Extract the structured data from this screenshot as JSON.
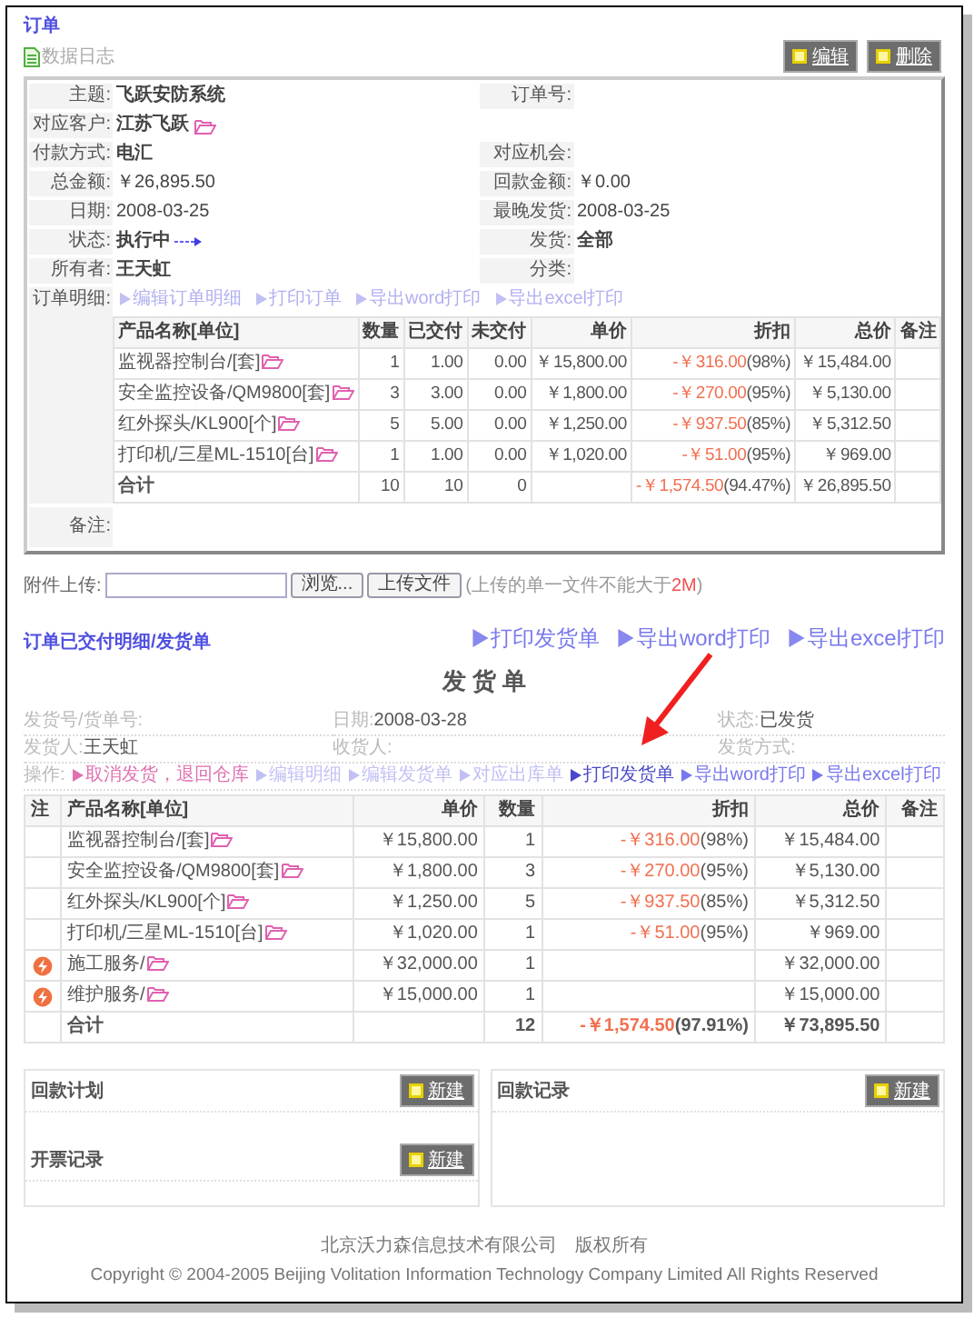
{
  "header": {
    "title": "订单",
    "log_link": "数据日志",
    "buttons": [
      "编辑",
      "删除"
    ]
  },
  "order_info": {
    "rows": [
      [
        {
          "label": "主题:",
          "value": "飞跃安防系统",
          "kind": "bold"
        },
        {
          "label": "订单号:"
        }
      ],
      [
        {
          "label": "对应客户:",
          "value": "江苏飞跃",
          "kind": "customer"
        }
      ],
      [
        {
          "label": "付款方式:",
          "value": "电汇",
          "kind": "bold"
        },
        {
          "label": "对应机会:"
        }
      ],
      [
        {
          "label": "总金额:",
          "value": "￥26,895.50",
          "kind": "plain"
        },
        {
          "label": "回款金额:",
          "value": "￥0.00",
          "kind": "plain"
        }
      ],
      [
        {
          "label": "日期:",
          "value": "2008-03-25",
          "kind": "plain"
        },
        {
          "label": "最晚发货:",
          "value": "2008-03-25",
          "kind": "plain"
        }
      ],
      [
        {
          "label": "状态:",
          "value": "执行中",
          "kind": "status"
        },
        {
          "label": "发货:",
          "value": "全部",
          "kind": "bold"
        }
      ],
      [
        {
          "label": "所有者:",
          "value": "王天虹",
          "kind": "bold"
        },
        {
          "label": "分类:"
        }
      ]
    ],
    "details_label": "订单明细:",
    "links": [
      "编辑订单明细",
      "打印订单",
      "导出word打印",
      "导出excel打印"
    ],
    "table": {
      "columns": [
        "**产品名称**[单位]",
        "数量",
        "已交付",
        "未交付",
        "单价",
        "折扣",
        "总价",
        "备注"
      ],
      "rows": [
        {
          "product": "监视器控制台/[套]",
          "quantity": "1",
          "delivered": "1.00",
          "undelivered": "0.00",
          "unit_price": "￥15,800.00",
          "discount": "-￥316.00",
          "discount_rate": "(98%)",
          "total": "￥15,484.00"
        },
        {
          "product": "安全监控设备/QM9800[套]",
          "quantity": "3",
          "delivered": "3.00",
          "undelivered": "0.00",
          "unit_price": "￥1,800.00",
          "discount": "-￥270.00",
          "discount_rate": "(95%)",
          "total": "￥5,130.00"
        },
        {
          "product": "红外探头/KL900[个]",
          "quantity": "5",
          "delivered": "5.00",
          "undelivered": "0.00",
          "unit_price": "￥1,250.00",
          "discount": "-￥937.50",
          "discount_rate": "(85%)",
          "total": "￥5,312.50"
        },
        {
          "product": "打印机/三星ML-1510[台]",
          "quantity": "1",
          "delivered": "1.00",
          "undelivered": "0.00",
          "unit_price": "￥1,020.00",
          "discount": "-￥51.00",
          "discount_rate": "(95%)",
          "total": "￥969.00"
        }
      ],
      "total": {
        "label": "合计",
        "quantity": "10",
        "delivered": "10",
        "undelivered": "0",
        "discount": "-￥1,574.50",
        "discount_rate": "(94.47%)",
        "total": "￥26,895.50"
      }
    },
    "remarks_label": "备注:"
  },
  "upload": {
    "label": "附件上传:",
    "browse_button": "浏览...",
    "upload_button": "上传文件",
    "note_before": "(上传的单一文件不能大于",
    "note_limit": "2M",
    "note_after": ")"
  },
  "delivery": {
    "title": "订单已交付明细/发货单",
    "links": [
      "打印发货单",
      "导出word打印",
      "导出excel打印"
    ],
    "heading": "发 货 单",
    "info": [
      [
        {
          "label": "发货号/货单号:"
        },
        {
          "label": "日期:",
          "value": "2008-03-28"
        },
        {
          "label": "状态:",
          "value": "已发货"
        }
      ],
      [
        {
          "label": "发货人:",
          "value": "王天虹"
        },
        {
          "label": "收货人:"
        },
        {
          "label": "发货方式:"
        }
      ]
    ],
    "actions_label": "操作:",
    "actions": [
      {
        "label": "取消发货，退回仓库",
        "kind": "cancel"
      },
      {
        "label": "编辑明细",
        "kind": "disabled"
      },
      {
        "label": "编辑发货单",
        "kind": "disabled"
      },
      {
        "label": "对应出库单",
        "kind": "disabled"
      },
      {
        "label": "打印发货单",
        "kind": "active"
      },
      {
        "label": "导出word打印",
        "kind": "normal"
      },
      {
        "label": "导出excel打印",
        "kind": "normal"
      }
    ],
    "table": {
      "columns": [
        "注",
        "**产品名称**[单位]",
        "单价",
        "数量",
        "折扣",
        "总价",
        "备注"
      ],
      "rows": [
        {
          "kind": "product",
          "product": "监视器控制台/[套]",
          "unit_price": "￥15,800.00",
          "quantity": "1",
          "discount": "-￥316.00",
          "discount_rate": "(98%)",
          "total": "￥15,484.00"
        },
        {
          "kind": "product",
          "product": "安全监控设备/QM9800[套]",
          "unit_price": "￥1,800.00",
          "quantity": "3",
          "discount": "-￥270.00",
          "discount_rate": "(95%)",
          "total": "￥5,130.00"
        },
        {
          "kind": "product",
          "product": "红外探头/KL900[个]",
          "unit_price": "￥1,250.00",
          "quantity": "5",
          "discount": "-￥937.50",
          "discount_rate": "(85%)",
          "total": "￥5,312.50"
        },
        {
          "kind": "product",
          "product": "打印机/三星ML-1510[台]",
          "unit_price": "￥1,020.00",
          "quantity": "1",
          "discount": "-￥51.00",
          "discount_rate": "(95%)",
          "total": "￥969.00"
        },
        {
          "kind": "service",
          "product": "施工服务/",
          "unit_price": "￥32,000.00",
          "quantity": "1",
          "total": "￥32,000.00"
        },
        {
          "kind": "service",
          "product": "维护服务/",
          "unit_price": "￥15,000.00",
          "quantity": "1",
          "total": "￥15,000.00"
        }
      ],
      "total": {
        "label": "合计",
        "quantity": "12",
        "discount": "-￥1,574.50",
        "discount_rate": "(97.91%)",
        "total": "￥73,895.50"
      }
    }
  },
  "panels": {
    "left": [
      {
        "title": "回款计划",
        "button": "新建"
      },
      {
        "title": "开票记录",
        "button": "新建"
      }
    ],
    "right": [
      {
        "title": "回款记录",
        "button": "新建"
      }
    ]
  },
  "footer": {
    "company": "北京沃力森信息技术有限公司　版权所有",
    "copyright": "Copyright © 2004-2005 Beijing Volitation Information Technology Company Limited All Rights Reserved"
  }
}
